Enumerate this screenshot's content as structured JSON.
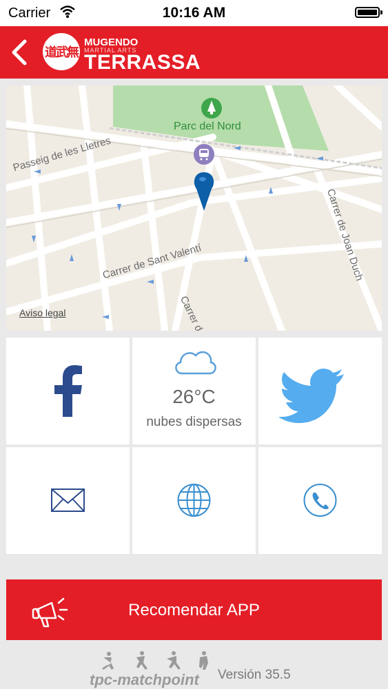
{
  "status_bar": {
    "carrier": "Carrier",
    "time": "10:16 AM"
  },
  "header": {
    "brand_top": "MUGENDO",
    "brand_sub": "MARTIAL ARTS",
    "brand_main": "TERRASSA",
    "logo_glyphs": "道武無"
  },
  "map": {
    "park_label": "Parc del Nord",
    "streets": [
      "Passeig de les Lletres",
      "Carrer de Sant Valentí",
      "Carrer de Joan Duch",
      "Carrer d"
    ],
    "legal": "Aviso legal"
  },
  "weather": {
    "temperature": "26°C",
    "description": "nubes dispersas"
  },
  "tiles": [
    {
      "name": "facebook",
      "icon": "facebook-icon"
    },
    {
      "name": "weather",
      "icon": "cloud-icon"
    },
    {
      "name": "twitter",
      "icon": "twitter-icon"
    },
    {
      "name": "email",
      "icon": "envelope-icon"
    },
    {
      "name": "web",
      "icon": "globe-icon"
    },
    {
      "name": "phone",
      "icon": "phone-icon"
    }
  ],
  "recommend": {
    "label": "Recomendar APP"
  },
  "footer": {
    "logo_text": "tpc-matchpoint",
    "version": "Versión 35.5"
  },
  "colors": {
    "brand_red": "#e41e26",
    "facebook_blue": "#2c4b8e",
    "twitter_blue": "#55acee",
    "map_pin": "#0d5fa8"
  }
}
